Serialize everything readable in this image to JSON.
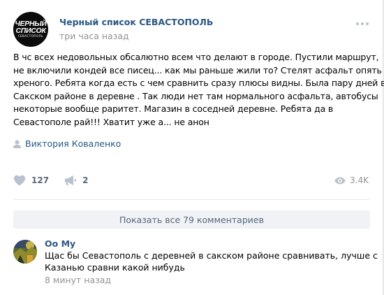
{
  "post": {
    "group_avatar": {
      "line1": "ЧЕРНЫЙ",
      "line2": "СПИСОК",
      "line3": "СЕВАСТОПОЛЬ"
    },
    "group_name": "Черный список СЕВАСТОПОЛЬ",
    "time": "три часа назад",
    "text_lines": [
      "В чс всех недовольных обсалютно всем что делают в городе. Пустили маршрут,",
      "не включили кондей все писец... как мы раньше жили то? Стелят асфальт опять",
      "хреного. Ребята когда есть с чем сравнить сразу плюсы видны. Была пару дней в",
      "Сакском районе в деревне . Так люди нет там нормального асфальта, автобусы",
      "некоторые вообще раритет. Магазин в соседней деревне. Ребята да в",
      "Севастополе рай!!! Хватит уже а... не анон"
    ],
    "author": "Виктория Коваленко",
    "likes": "127",
    "shares": "2",
    "views": "3.4K"
  },
  "comments": {
    "show_all_label": "Показать все 79 комментариев",
    "items": [
      {
        "author": "Оо Му",
        "text_lines": [
          "Щас бы Севастополь с деревней в сакском районе сравнивать, лучше с",
          "Казанью сравни какой нибудь"
        ],
        "time": "8 минут назад"
      }
    ]
  },
  "colors": {
    "link": "#2a5885",
    "meta": "#939393",
    "icon": "#b8c1cc",
    "button_bg": "#f0f2f5"
  }
}
